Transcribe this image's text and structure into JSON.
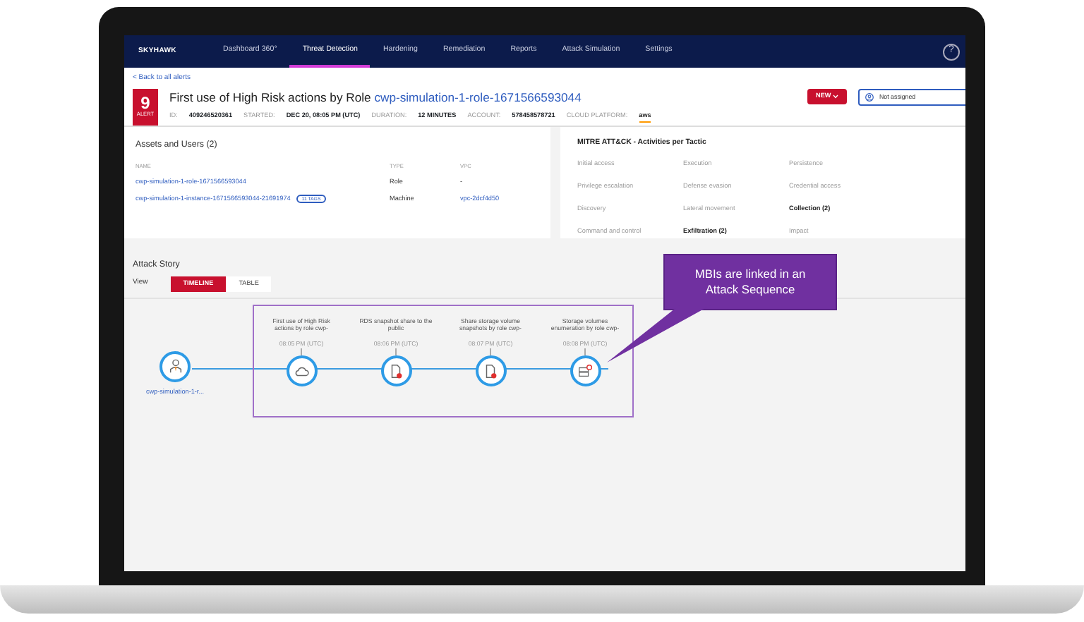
{
  "nav": {
    "logo": "SKYHAWK",
    "items": [
      {
        "label": "Dashboard 360°",
        "selected": false
      },
      {
        "label": "Threat Detection",
        "selected": true
      },
      {
        "label": "Hardening",
        "selected": false
      },
      {
        "label": "Remediation",
        "selected": false
      },
      {
        "label": "Reports",
        "selected": false
      },
      {
        "label": "Attack Simulation",
        "selected": false
      },
      {
        "label": "Settings",
        "selected": false
      }
    ],
    "help": "?"
  },
  "back_link": "< Back to all alerts",
  "alert": {
    "count": "9",
    "label": "ALERT",
    "title": "First use of High Risk actions by Role",
    "title_link": "cwp-simulation-1-role-1671566593044",
    "meta": [
      {
        "label": "ID:",
        "value": "409246520361"
      },
      {
        "label": "STARTED:",
        "value": "DEC 20, 08:05 PM (UTC)"
      },
      {
        "label": "DURATION:",
        "value": "12 MINUTES"
      },
      {
        "label": "ACCOUNT:",
        "value": "578458578721"
      },
      {
        "label": "CLOUD PLATFORM:",
        "value": "aws"
      }
    ],
    "status": "NEW",
    "assignee": "Not assigned"
  },
  "assets": {
    "title": "Assets and Users (2)",
    "columns": [
      "NAME",
      "TYPE",
      "VPC"
    ],
    "rows": [
      {
        "name": "cwp-simulation-1-role-1671566593044",
        "type": "Role",
        "vpc": "-"
      },
      {
        "name": "cwp-simulation-1-instance-1671566593044-21691974",
        "tag": "11 TAGS",
        "type": "Machine",
        "vpc": "vpc-2dcf4d50"
      }
    ]
  },
  "mitre": {
    "title": "MITRE ATT&CK - Activities per Tactic",
    "tactics": [
      {
        "label": "Initial access",
        "active": false
      },
      {
        "label": "Execution",
        "active": false
      },
      {
        "label": "Persistence",
        "active": false
      },
      {
        "label": "Privilege escalation",
        "active": false
      },
      {
        "label": "Defense evasion",
        "active": false
      },
      {
        "label": "Credential access",
        "active": false
      },
      {
        "label": "Discovery",
        "active": false
      },
      {
        "label": "Lateral movement",
        "active": false
      },
      {
        "label": "Collection (2)",
        "active": true
      },
      {
        "label": "Command and control",
        "active": false
      },
      {
        "label": "Exfiltration (2)",
        "active": true
      },
      {
        "label": "Impact",
        "active": false
      }
    ]
  },
  "attack_story": {
    "title": "Attack Story",
    "view_label": "View",
    "view_tabs": [
      {
        "label": "TIMELINE",
        "selected": true
      },
      {
        "label": "TABLE",
        "selected": false
      }
    ],
    "source": {
      "label": "cwp-simulation-1-r..."
    },
    "events": [
      {
        "kind": "cloud",
        "title": "First use of High Risk actions by role cwp-",
        "time": "08:05 PM (UTC)"
      },
      {
        "kind": "document",
        "title": "RDS snapshot share to the public",
        "time": "08:06 PM (UTC)"
      },
      {
        "kind": "document",
        "title": "Share storage volume snapshots by role cwp-",
        "time": "08:07 PM (UTC)"
      },
      {
        "kind": "server",
        "title": "Storage volumes enumeration by role cwp-",
        "time": "08:08 PM (UTC)"
      }
    ]
  },
  "callout": "MBIs are linked in an Attack Sequence"
}
